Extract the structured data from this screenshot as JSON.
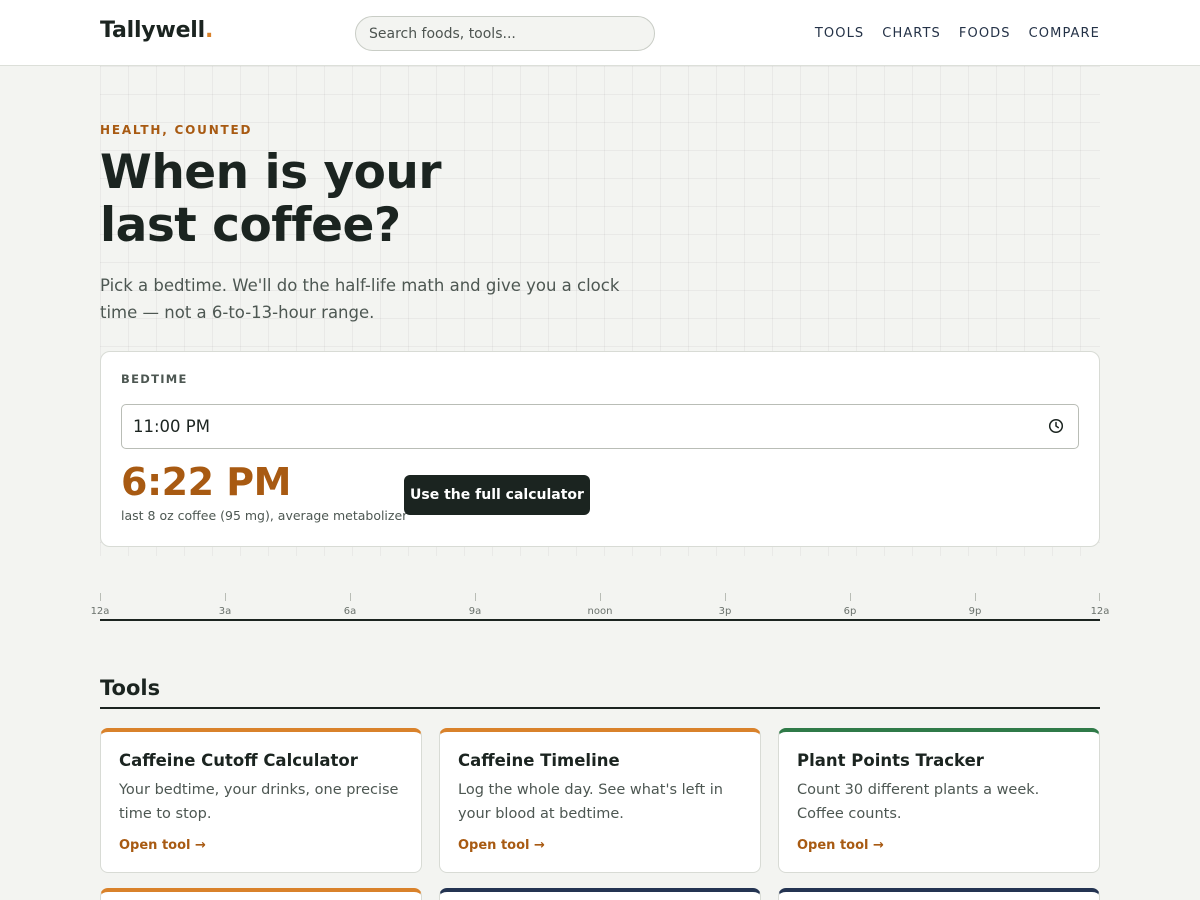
{
  "header": {
    "brand": "Tallywell",
    "brand_dot": ".",
    "search_placeholder": "Search foods, tools...",
    "nav": [
      "TOOLS",
      "CHARTS",
      "FOODS",
      "COMPARE"
    ]
  },
  "hero": {
    "eyebrow": "HEALTH, COUNTED",
    "title_line1": "When is your",
    "title_line2": "last coffee?",
    "subtitle": "Pick a bedtime. We'll do the half-life math and give you a clock time — not a 6-to-13-hour range."
  },
  "bedtime_card": {
    "label": "BEDTIME",
    "input_value": "11:00 PM",
    "input_icon": "clock-icon",
    "result_time": "6:22 PM",
    "result_note": "last 8 oz coffee (95 mg), average metabolizer",
    "cta_label": "Use the full calculator"
  },
  "timeline": {
    "labels": [
      "12a",
      "3a",
      "6a",
      "9a",
      "noon",
      "3p",
      "6p",
      "9p",
      "12a"
    ]
  },
  "tools": {
    "heading": "Tools",
    "cards": [
      {
        "name": "Caffeine Cutoff Calculator",
        "description": "Your bedtime, your drinks, one precise time to stop.",
        "link": "Open tool →",
        "accent": "#d9822b"
      },
      {
        "name": "Caffeine Timeline",
        "description": "Log the whole day. See what's left in your blood at bedtime.",
        "link": "Open tool →",
        "accent": "#d9822b"
      },
      {
        "name": "Plant Points Tracker",
        "description": "Count 30 different plants a week. Coffee counts.",
        "link": "Open tool →",
        "accent": "#2f7a48"
      }
    ],
    "peek_accents": [
      "#d9822b",
      "#243452",
      "#243452"
    ]
  },
  "colors": {
    "accent_orange": "#d9822b",
    "accent_brown": "#a85a12",
    "ink": "#1b2420",
    "background": "#f3f4f1"
  }
}
